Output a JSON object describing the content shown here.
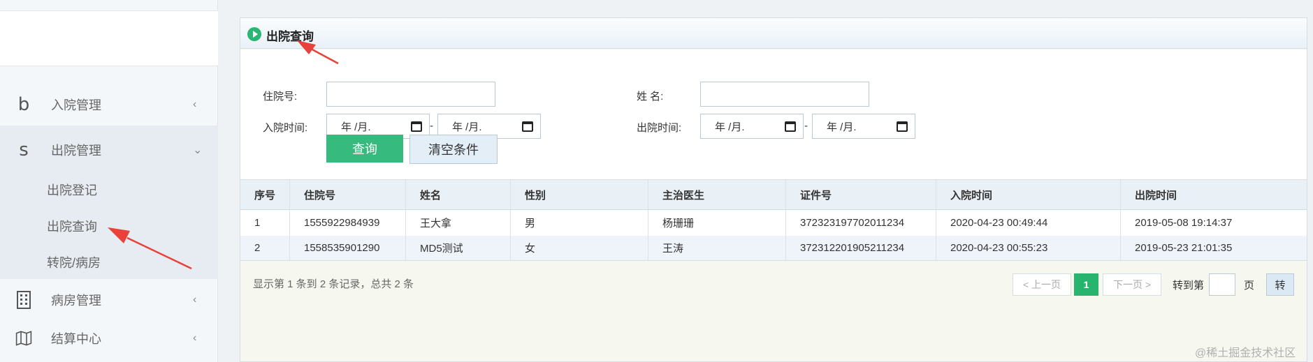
{
  "sidebar": {
    "menus": [
      {
        "icon": "b",
        "label": "入院管理",
        "arrow": "‹"
      },
      {
        "icon": "s",
        "label": "出院管理",
        "arrow": "⌄"
      },
      {
        "icon": "building-icon",
        "label": "病房管理",
        "arrow": "‹"
      },
      {
        "icon": "map-icon",
        "label": "结算中心",
        "arrow": "‹"
      }
    ],
    "sub_items": [
      "出院登记",
      "出院查询",
      "转院/病房"
    ]
  },
  "panel": {
    "title": "出院查询"
  },
  "form": {
    "admission_no_label": "住院号:",
    "name_label": "姓 名:",
    "admit_time_label": "入院时间:",
    "discharge_time_label": "出院时间:",
    "date_placeholder": "年 /月.",
    "dash": "-",
    "search_button": "查询",
    "clear_button": "清空条件"
  },
  "table": {
    "headers": [
      "序号",
      "住院号",
      "姓名",
      "性别",
      "主治医生",
      "证件号",
      "入院时间",
      "出院时间"
    ],
    "rows": [
      [
        "1",
        "1555922984939",
        "王大拿",
        "男",
        "杨珊珊",
        "372323197702011234",
        "2020-04-23 00:49:44",
        "2019-05-08 19:14:37"
      ],
      [
        "2",
        "1558535901290",
        "MD5测试",
        "女",
        "王涛",
        "372312201905211234",
        "2020-04-23 00:55:23",
        "2019-05-23 21:01:35"
      ]
    ]
  },
  "pagination": {
    "summary": "显示第 1 条到 2 条记录，总共 2 条",
    "prev": "< 上一页",
    "current": "1",
    "next": "下一页 >",
    "goto_label": "转到第",
    "page_unit": "页",
    "go_button": "转"
  },
  "watermark": "@稀土掘金技术社区",
  "colors": {
    "primary": "#37ba7d",
    "annotation_arrow": "#e8423a"
  }
}
